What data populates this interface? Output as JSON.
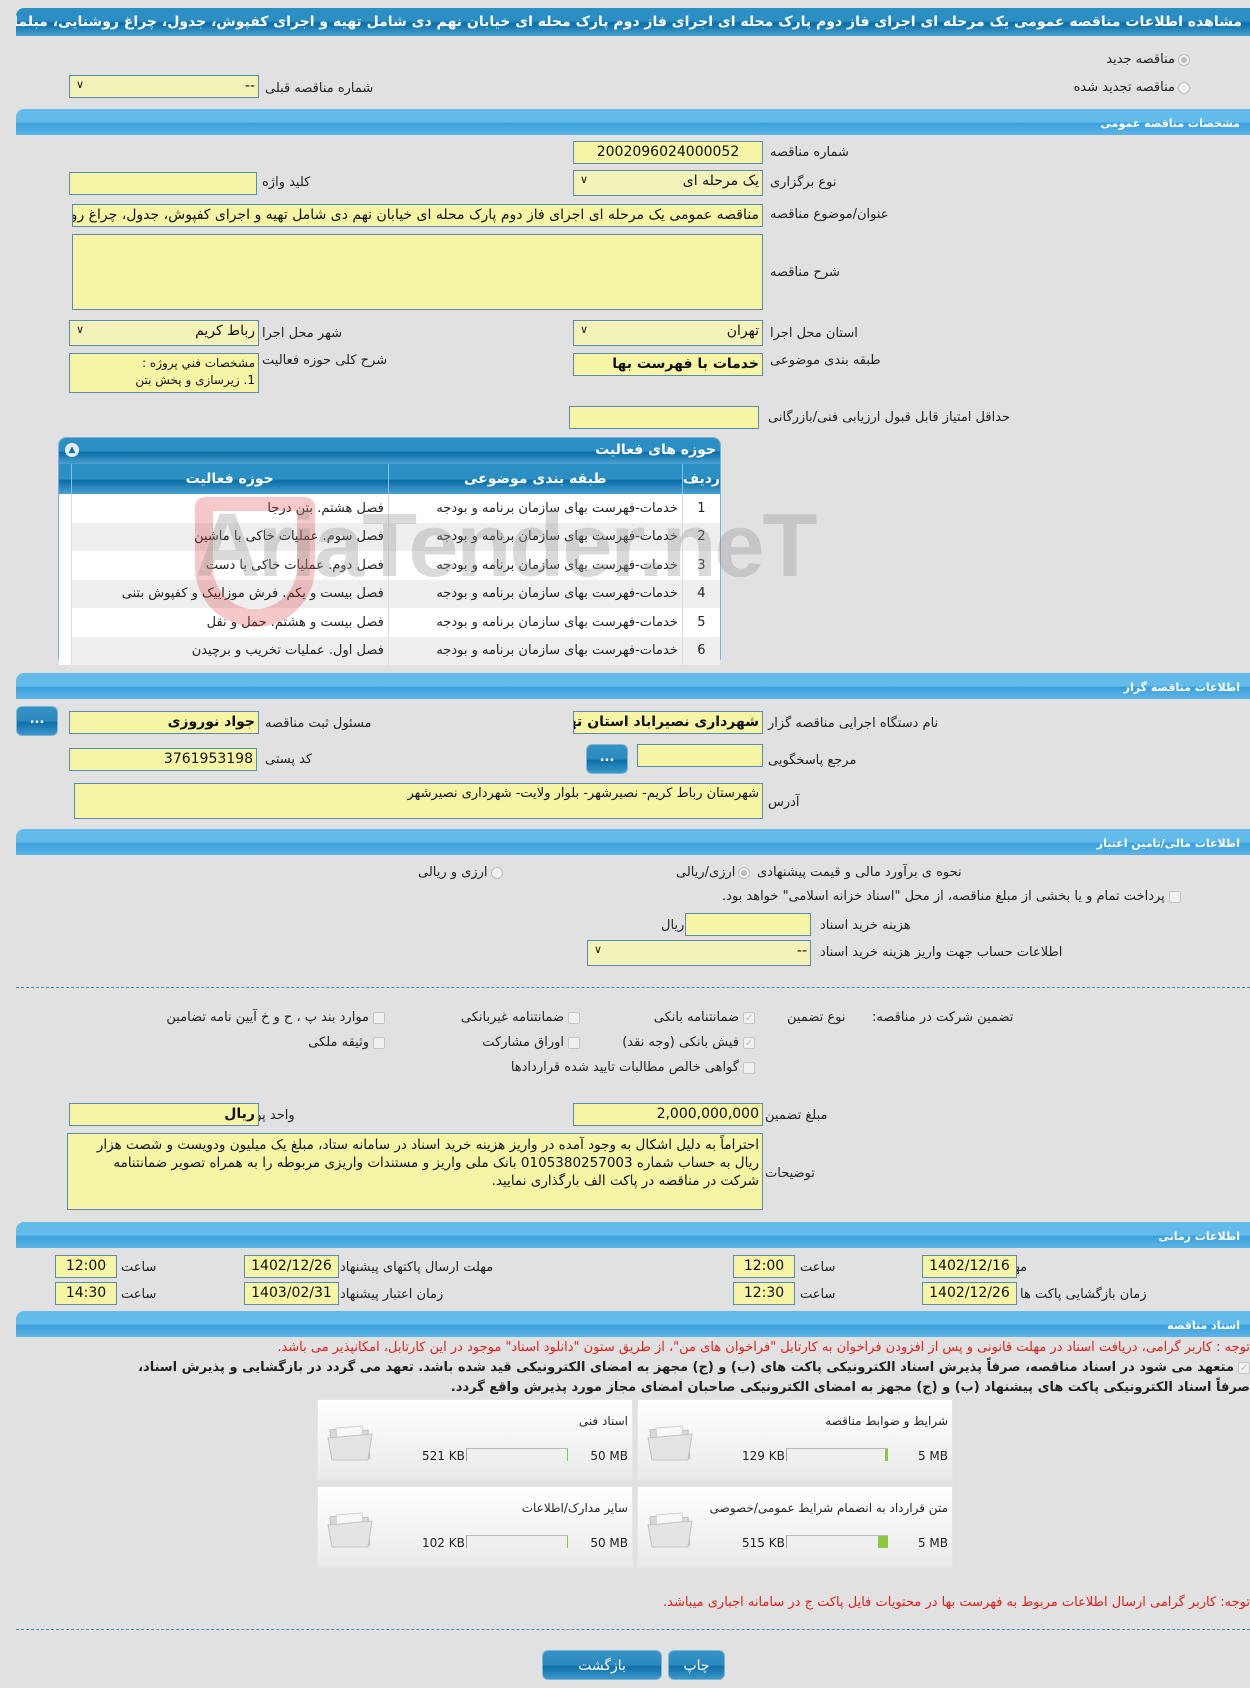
{
  "header": {
    "title": "مشاهده اطلاعات مناقصه عمومی یک مرحله ای اجرای فاز دوم پارک محله ای اجرای فاز دوم پارک محله ای خیابان نهم دی شامل تهیه و اجرای کفپوش، جدول، چراغ روشنایی، مبلمان شهری"
  },
  "top": {
    "radio_new": "مناقصه جدید",
    "radio_renewed": "مناقصه تجدید شده",
    "prev_number_label": "شماره مناقصه قبلی",
    "prev_number_value": "--"
  },
  "general": {
    "section_title": "مشخصات مناقصه عمومی",
    "number_label": "شماره مناقصه",
    "number_value": "2002096024000052",
    "type_label": "نوع برگزاری",
    "type_value": "یک مرحله ای",
    "keyword_label": "کلید واژه",
    "keyword_value": "",
    "subject_label": "عنوان/موضوع مناقصه",
    "subject_value": "مناقصه عمومی یک مرحله ای  اجرای فاز دوم پارک محله ای خیابان نهم دی شامل تهیه و اجرای کفپوش، جدول، چراغ روشنایی، مبلمان شهری",
    "description_label": "شرح مناقصه",
    "description_value": "",
    "province_label": "استان محل اجرا",
    "province_value": "تهران",
    "city_label": "شهر محل اجرا",
    "city_value": "رباط کریم",
    "category_label": "طبقه بندی موضوعی",
    "category_value": "خدمات با فهرست بها",
    "activity_desc_label": "شرح کلی حوزه فعالیت",
    "activity_desc_line1": "مشخصات فني پروژه :",
    "activity_desc_line2": "1.     زیرسازی و پخش بتن",
    "min_score_label": "حداقل امتیاز قابل قبول ارزیابی فنی/بازرگانی",
    "min_score_value": ""
  },
  "activities": {
    "title": "حوزه های فعالیت",
    "columns": [
      "ردیف",
      "طبقه بندی موضوعی",
      "حوزه فعالیت"
    ],
    "rows": [
      {
        "n": "1",
        "category": "خدمات-فهرست بهای سازمان برنامه و بودجه",
        "field": "فصل هشتم. بتن درجا"
      },
      {
        "n": "2",
        "category": "خدمات-فهرست بهای سازمان برنامه و بودجه",
        "field": "فصل سوم. عملیات خاکی با ماشین"
      },
      {
        "n": "3",
        "category": "خدمات-فهرست بهای سازمان برنامه و بودجه",
        "field": "فصل دوم. عملیات خاکی با دست"
      },
      {
        "n": "4",
        "category": "خدمات-فهرست بهای سازمان برنامه و بودجه",
        "field": "فصل بیست و یکم. فرش موزاییک و کفپوش بتنی"
      },
      {
        "n": "5",
        "category": "خدمات-فهرست بهای سازمان برنامه و بودجه",
        "field": "فصل بیست و هشتم. حمل و نقل"
      },
      {
        "n": "6",
        "category": "خدمات-فهرست بهای سازمان برنامه و بودجه",
        "field": "فصل اول. عملیات تخریب و برچیدن"
      }
    ]
  },
  "watermark": "AriaTender.neT",
  "organizer": {
    "section_title": "اطلاعات مناقصه گزار",
    "org_label": "نام دستگاه اجرایی مناقصه گزار",
    "org_value": "شهرداری نصیراباد استان تهران",
    "responsible_label": "مسئول ثبت مناقصه",
    "responsible_value": "جواد نوروزی",
    "reference_label": "مرجع پاسخگویی",
    "reference_value": "",
    "postal_label": "کد پستی",
    "postal_value": "3761953198",
    "address_label": "آدرس",
    "address_value": "شهرستان رباط کریم- نصیرشهر- بلوار ولایت- شهرداری نصیرشهر",
    "dots": "..."
  },
  "financial": {
    "section_title": "اطلاعات مالی/تامین اعتبار",
    "estimate_label": "نحوه ی برآورد مالی و قیمت پیشنهادی",
    "opt_rial": "ارزی/ریالی",
    "opt_both": "ارزی و ریالی",
    "treasury_text": "پرداخت تمام و یا بخشی از مبلغ مناقصه، از محل \"اسناد خزانه اسلامی\" خواهد بود.",
    "doc_cost_label": "هزینه خرید اسناد",
    "doc_cost_value": "",
    "doc_cost_unit": "ریال",
    "account_label": "اطلاعات حساب جهت واریز هزینه خرید اسناد",
    "account_value": "--"
  },
  "guarantee": {
    "label": "تضمین شرکت در مناقصه:",
    "type_label": "نوع تضمین",
    "options": [
      {
        "label": "ضمانتنامه بانکی",
        "checked": true
      },
      {
        "label": "ضمانتنامه غیربانکی",
        "checked": false
      },
      {
        "label": "موارد بند پ ، ح و خ آیین نامه تضامین",
        "checked": false
      },
      {
        "label": "فیش بانکی (وجه نقد)",
        "checked": true
      },
      {
        "label": "اوراق مشارکت",
        "checked": false
      },
      {
        "label": "وثیقه ملکی",
        "checked": false
      },
      {
        "label": "گواهی خالص مطالبات تایید شده قراردادها",
        "checked": false
      }
    ],
    "amount_label": "مبلغ تضمین",
    "amount_value": "2,000,000,000",
    "currency_label": "واحد پول",
    "currency_value": "ریال",
    "notes_label": "توضیحات",
    "notes_value": "احتراماً به دلیل اشکال به وجود آمده در واریز هزینه خرید اسناد در سامانه ستاد، مبلغ یک میلیون ودویست و شصت هزار ریال به حساب شماره 0105380257003 بانک ملی واریز و مستندات واریزی مربوطه را به همراه تصویر ضمانتنامه شرکت در مناقصه در پاکت الف بارگذاری نمایید."
  },
  "timing": {
    "section_title": "اطلاعات زمانی",
    "doc_deadline_label": "مهلت دریافت اسناد",
    "doc_deadline_date": "1402/12/16",
    "doc_deadline_time": "12:00",
    "submit_deadline_label": "مهلت ارسال پاکتهای پیشنهاد",
    "submit_deadline_date": "1402/12/26",
    "submit_deadline_time": "12:00",
    "opening_label": "زمان بازگشایی پاکت ها",
    "opening_date": "1402/12/26",
    "opening_time": "12:30",
    "validity_label": "زمان اعتبار پیشنهاد",
    "validity_date": "1403/02/31",
    "validity_time": "14:30",
    "time_label": "ساعت"
  },
  "documents": {
    "section_title": "اسناد مناقصه",
    "note_top": "توجه : کاربر گرامی، دریافت اسناد در مهلت قانونی و پس از افزودن فراخوان به کارتابل \"فراخوان های من\"، از طریق ستون \"دانلود اسناد\" موجود در این کارتابل، امکانپذیر می باشد.",
    "commit_line1": "متعهد می شود در اسناد مناقصه، صرفاً پذیرش اسناد الکترونیکی پاکت های (ب) و (ج) مجهز به امضای الکترونیکی قید شده باشد. تعهد می گردد در بازگشایی و پذیرش اسناد،",
    "commit_line2": "صرفاً اسناد الکترونیکی پاکت های پیشنهاد (ب) و (ج) مجهز به امضای الکترونیکی صاحبان امضای مجاز مورد پذیرش واقع گردد.",
    "items": [
      {
        "name": "شرایط و ضوابط مناقصه",
        "size": "129 KB",
        "max": "5 MB",
        "fill_percent": 2.5
      },
      {
        "name": "اسناد فنی",
        "size": "521 KB",
        "max": "50 MB",
        "fill_percent": 1.0
      },
      {
        "name": "متن قرارداد به انضمام شرایط عمومی/خصوصی",
        "size": "515 KB",
        "max": "5 MB",
        "fill_percent": 10.1
      },
      {
        "name": "سایر مدارک/اطلاعات",
        "size": "102 KB",
        "max": "50 MB",
        "fill_percent": 0.2
      }
    ],
    "note_bottom": "توجه: کاربر گرامی ارسال اطلاعات مربوط به فهرست بها در محتویات فایل پاکت ج در سامانه اجباری میباشد."
  },
  "actions": {
    "print": "چاپ",
    "back": "بازگشت"
  }
}
